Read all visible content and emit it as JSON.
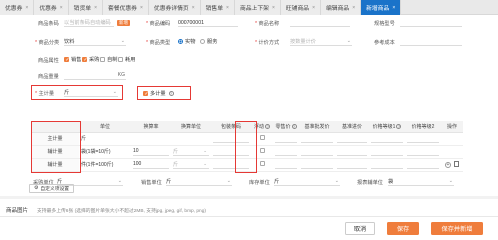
{
  "tabs": [
    {
      "label": "优惠券"
    },
    {
      "label": "优惠券"
    },
    {
      "label": "销货单"
    },
    {
      "label": "套餐优惠券"
    },
    {
      "label": "优惠券详情页"
    },
    {
      "label": "销售单"
    },
    {
      "label": "商品上下架"
    },
    {
      "label": "旺铺商品"
    },
    {
      "label": "编辑商品"
    },
    {
      "label": "新增商品"
    }
  ],
  "tab_close_glyph": "×",
  "form": {
    "barcode_label": "商品条码",
    "barcode_placeholder": "以当前条码自动编码",
    "barcode_tag": "新增",
    "code_label": "商品编码",
    "code_value": "000700001",
    "name_label": "商品名称",
    "spec_label": "规格型号",
    "category_label": "商品分类",
    "category_value": "饮料",
    "type_label": "商品类型",
    "type_options": [
      "实物",
      "服务"
    ],
    "pricing_label": "计价方式",
    "pricing_placeholder": "按数量计价",
    "ref_cost_label": "参考成本",
    "attr_label": "商品属性",
    "attr_options": [
      {
        "label": "销售",
        "checked": true
      },
      {
        "label": "采购",
        "checked": true
      },
      {
        "label": "自制",
        "checked": false
      },
      {
        "label": "耗用",
        "checked": false
      }
    ],
    "weight_label": "商品重量",
    "weight_unit": "KG",
    "main_unit_label": "主计量",
    "main_unit_value": "斤",
    "multi_unit_label": "多计量",
    "multi_unit_checked": true
  },
  "unit_table": {
    "headers": [
      "",
      "单位",
      "换算率",
      "换算单位",
      "包装条码",
      "浮动",
      "零售价",
      "基准批发价",
      "基准进价",
      "价格等级1",
      "价格等级2",
      "操作"
    ],
    "rows": [
      {
        "type": "主计量",
        "unit": "斤",
        "rate": "",
        "conv_unit": ""
      },
      {
        "type": "辅计量",
        "unit": "袋(1袋=10斤)",
        "rate": "10",
        "conv_unit": "斤"
      },
      {
        "type": "辅计量",
        "unit": "件(1件=100斤)",
        "rate": "100",
        "conv_unit": "斤"
      }
    ]
  },
  "units_bottom": {
    "purchase_label": "采购单位",
    "purchase_value": "斤",
    "sales_label": "销售单位",
    "sales_value": "斤",
    "stock_label": "库存单位",
    "stock_value": "斤",
    "report_label": "报表辅单位",
    "report_value": "袋"
  },
  "custom_settings_label": "自定义项设置",
  "images": {
    "label": "商品图片",
    "hint": "支持最多上传6张 (选择的图片单张大小不超过2MB, 支持jpg, jpeg, gif, bmp, png)"
  },
  "buttons": {
    "cancel": "取消",
    "save": "保存",
    "save_new": "保存并新增"
  },
  "colors": {
    "accent_blue": "#1a73c9",
    "accent_orange": "#ef7d3c",
    "highlight_red": "#e53935"
  }
}
